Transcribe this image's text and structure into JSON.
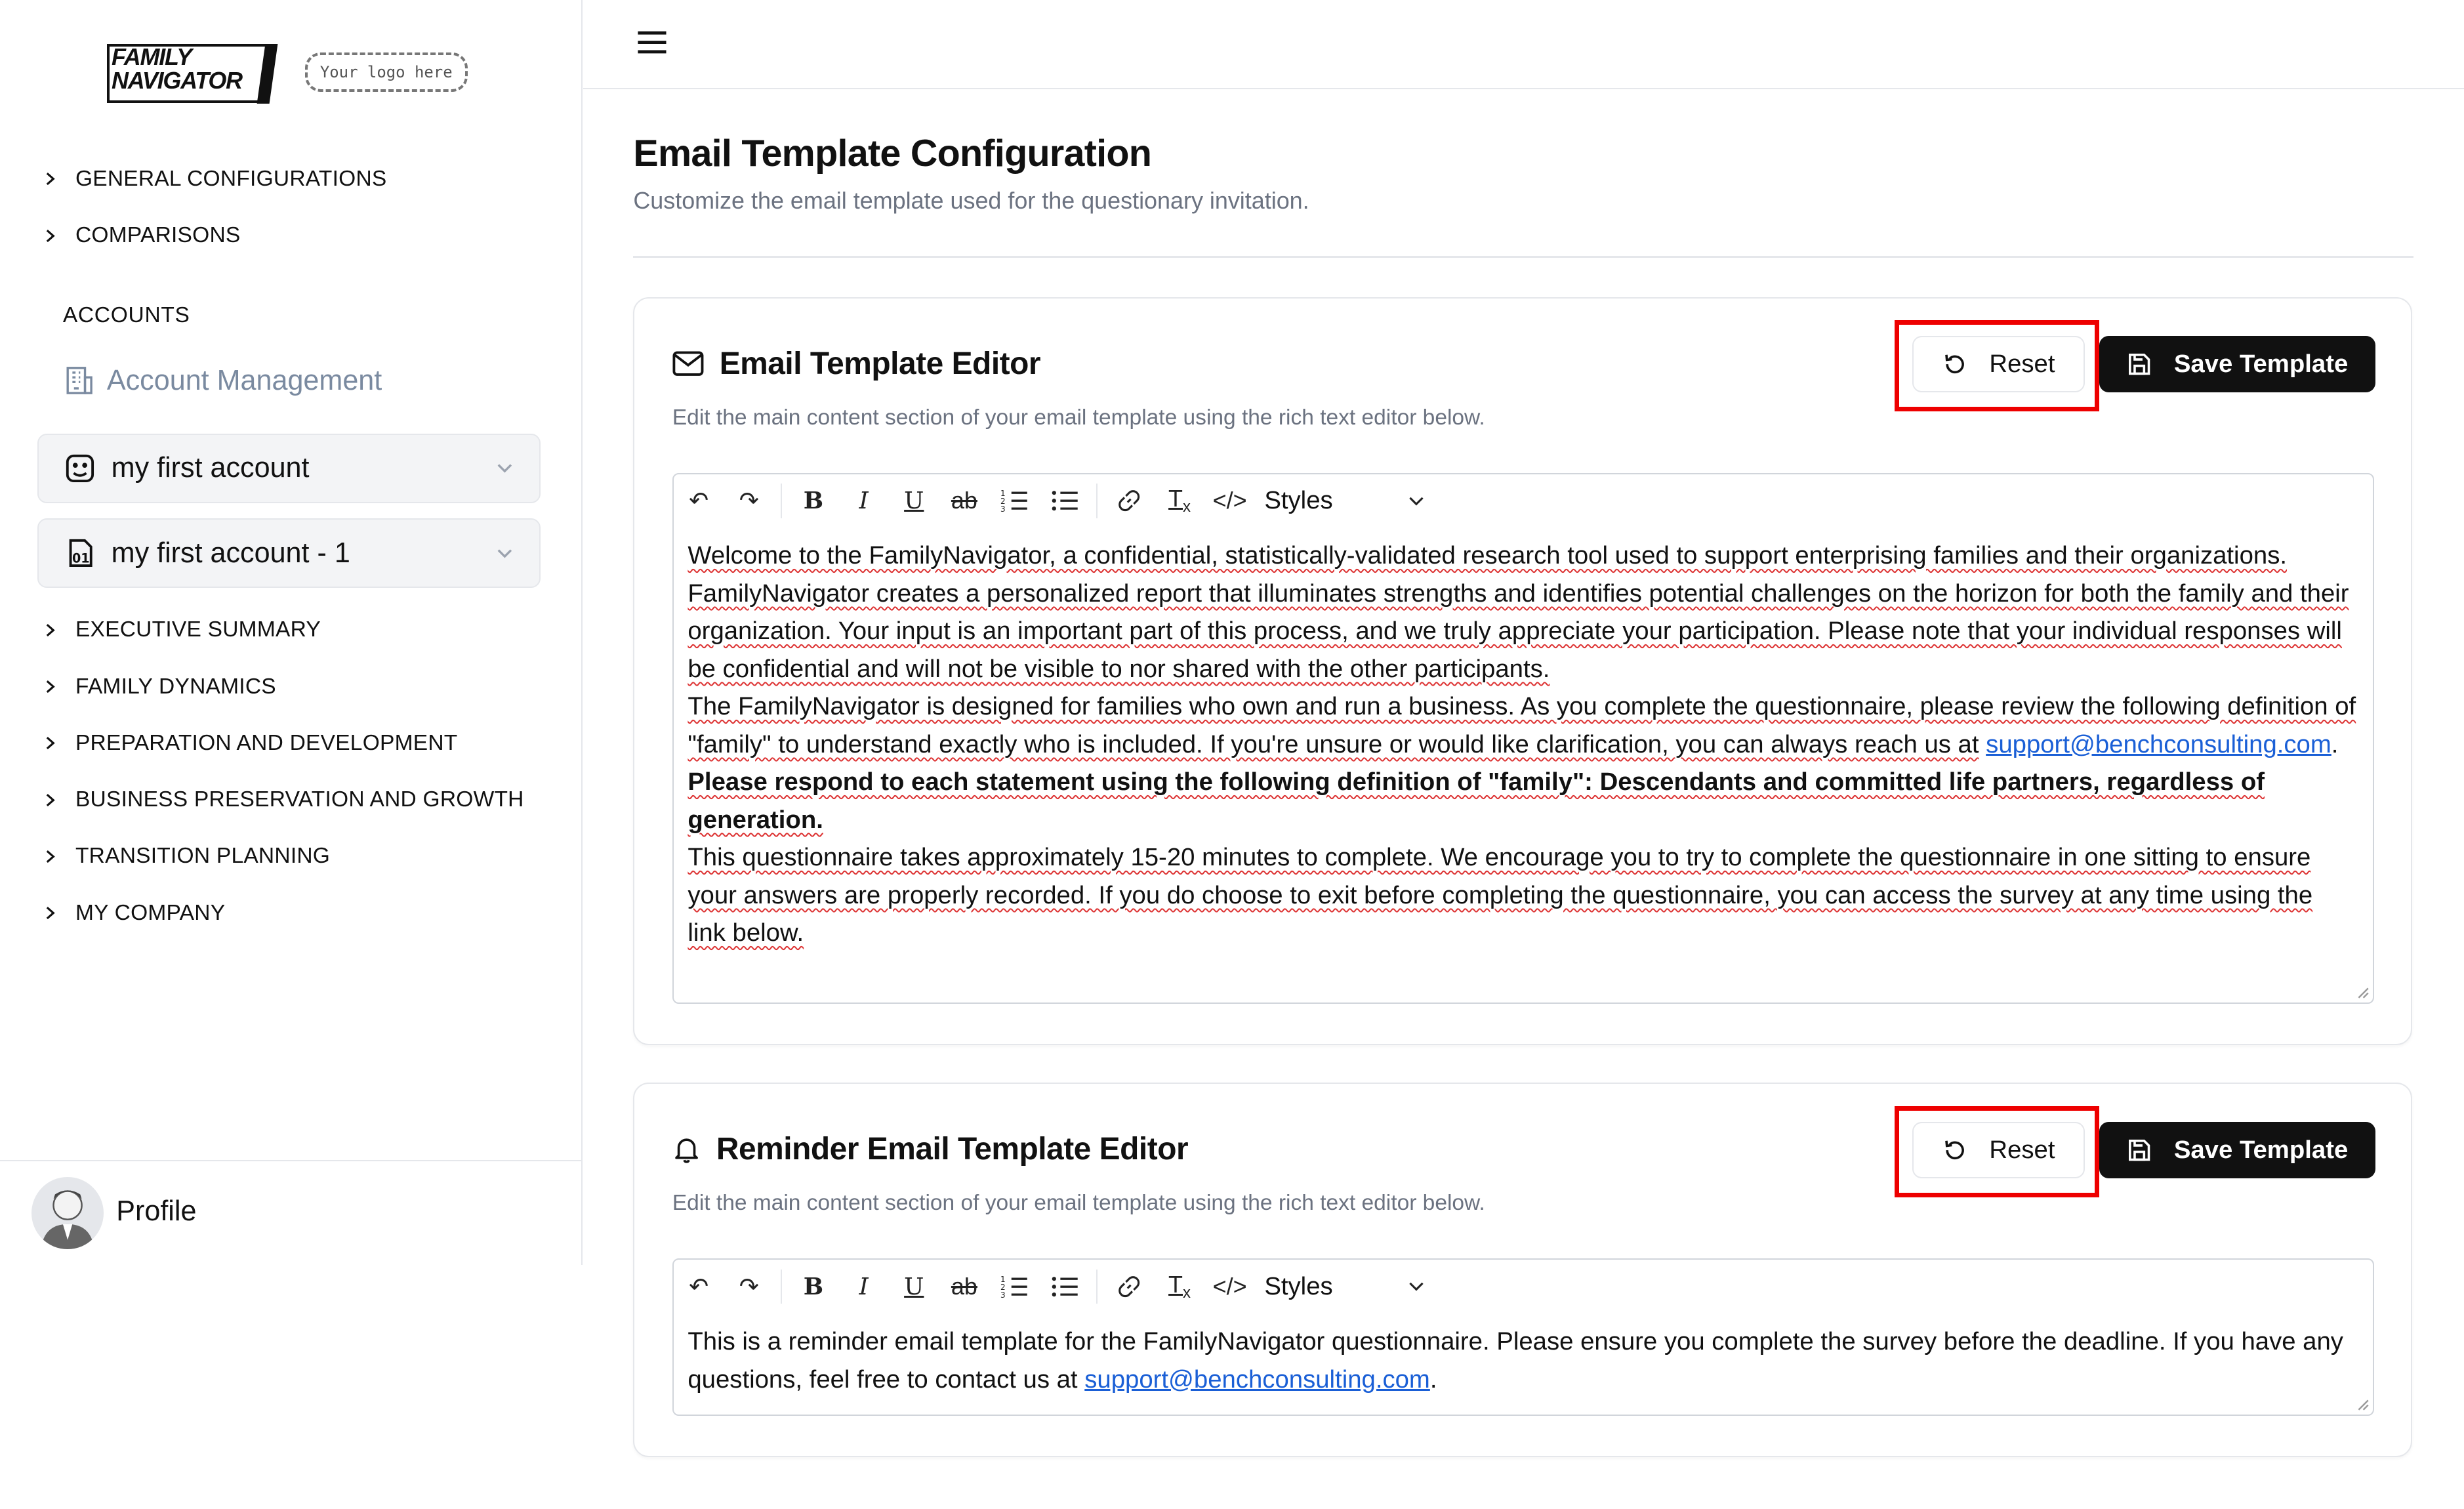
{
  "sidebar": {
    "logo_text_line1": "FAMILY",
    "logo_text_line2": "NAVIGATOR",
    "logo_placeholder": "Your logo here",
    "top_nav": [
      "GENERAL CONFIGURATIONS",
      "COMPARISONS"
    ],
    "accounts_label": "ACCOUNTS",
    "account_management": "Account Management",
    "accounts": [
      "my first account",
      "my first account - 1"
    ],
    "sections": [
      "EXECUTIVE SUMMARY",
      "FAMILY DYNAMICS",
      "PREPARATION AND DEVELOPMENT",
      "BUSINESS PRESERVATION AND GROWTH",
      "TRANSITION PLANNING",
      "MY COMPANY"
    ],
    "profile_label": "Profile"
  },
  "page": {
    "title": "Email Template Configuration",
    "subtitle": "Customize the email template used for the questionary invitation."
  },
  "cards": {
    "main": {
      "title": "Email Template Editor",
      "description": "Edit the main content section of your email template using the rich text editor below.",
      "reset_label": "Reset",
      "save_label": "Save Template",
      "styles_label": "Styles",
      "p1": "Welcome to the FamilyNavigator, a confidential, statistically-validated research tool used to support enterprising families and their organizations. FamilyNavigator creates a personalized report that illuminates strengths and identifies potential challenges on the horizon for both the family and their organization. Your input is an important part of this process, and we truly appreciate your participation. Please note that your individual responses will be confidential and will not be visible to nor shared with the other participants.",
      "p2": "The FamilyNavigator is designed for families who own and run a business. As you complete the questionnaire, please review the following definition of \"family\" to understand exactly who is included. If you're unsure or would like clarification, you can always reach us at",
      "p2_link": "support@benchconsulting.com",
      "p3": "Please respond to each statement using the following definition of \"family\": Descendants and committed life partners, regardless of generation.",
      "p4": "This questionnaire takes approximately 15-20 minutes to complete. We encourage you to try to complete the questionnaire in one sitting to ensure your answers are properly recorded. If you do choose to exit before completing the questionnaire, you can access the survey at any time using the link below."
    },
    "reminder": {
      "title": "Reminder Email Template Editor",
      "description": "Edit the main content section of your email template using the rich text editor below.",
      "reset_label": "Reset",
      "save_label": "Save Template",
      "styles_label": "Styles",
      "p1": "This is a reminder email template for the FamilyNavigator questionnaire. Please ensure you complete the survey before the deadline. If you have any questions, feel free to contact us at",
      "p1_link": "support@benchconsulting.com"
    }
  },
  "colors": {
    "highlight": "#e00000",
    "primary_button": "#111111",
    "link": "#1a5fd6",
    "muted_text": "#6b7280"
  },
  "icons": [
    "menu-icon",
    "chevron-right-icon",
    "building-icon",
    "account-icon",
    "chevron-down-icon",
    "mail-icon",
    "bell-icon",
    "reset-icon",
    "save-icon",
    "undo-icon",
    "redo-icon",
    "bold-icon",
    "italic-icon",
    "underline-icon",
    "strikethrough-icon",
    "ordered-list-icon",
    "bullet-list-icon",
    "link-icon",
    "clear-format-icon",
    "code-icon"
  ]
}
